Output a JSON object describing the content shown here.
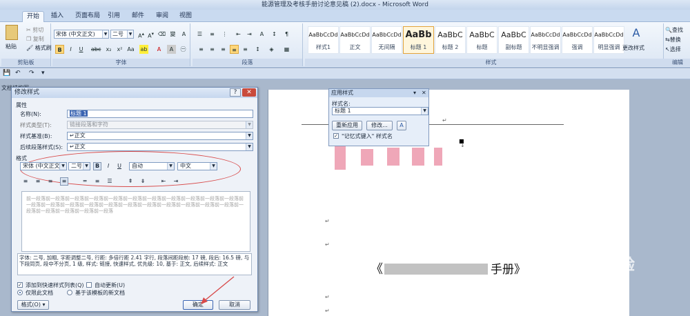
{
  "window": {
    "title": "能源管理及考核手册讨论意见稿 (2).docx - Microsoft Word"
  },
  "tabs": [
    "开始",
    "插入",
    "页面布局",
    "引用",
    "邮件",
    "审阅",
    "视图"
  ],
  "ribbon": {
    "clipboard": {
      "paste": "粘贴",
      "cut": "剪切",
      "copy": "复制",
      "format_painter": "格式刷",
      "label": "剪贴板"
    },
    "font": {
      "name": "宋体 (中文正文)",
      "size": "二号",
      "label": "字体"
    },
    "paragraph": {
      "label": "段落"
    },
    "styles": {
      "label": "样式",
      "change_styles": "更改样式",
      "tiles": [
        {
          "sample": "AaBbCcDd",
          "name": "样式1"
        },
        {
          "sample": "AaBbCcDd",
          "name": "正文"
        },
        {
          "sample": "AaBbCcDd",
          "name": "无间隔"
        },
        {
          "sample": "AaBb",
          "name": "标题 1"
        },
        {
          "sample": "AaBbC",
          "name": "标题 2"
        },
        {
          "sample": "AaBbC",
          "name": "标题"
        },
        {
          "sample": "AaBbC",
          "name": "副标题"
        },
        {
          "sample": "AaBbCcDd",
          "name": "不明显强调"
        },
        {
          "sample": "AaBbCcDd",
          "name": "强调"
        },
        {
          "sample": "AaBbCcDd",
          "name": "明显强调"
        }
      ]
    },
    "editing": {
      "find": "查找",
      "replace": "替换",
      "select": "选择",
      "label": "编辑"
    }
  },
  "nav_label": "文档结构图",
  "apply_pane": {
    "title": "应用样式",
    "name_label": "样式名:",
    "name_value": "标题 1",
    "reapply": "重新应用",
    "modify": "修改...",
    "autocomplete": "\"记忆式键入\" 样式名"
  },
  "dialog": {
    "title": "修改样式",
    "help": "?",
    "properties_label": "属性",
    "name_label": "名称(N):",
    "name_value": "标题 1",
    "type_label": "样式类型(T):",
    "type_value": "链接段落和字符",
    "based_label": "样式基准(B):",
    "based_value": "正文",
    "next_label": "后续段落样式(S):",
    "next_value": "正文",
    "format_label": "格式",
    "font_value": "宋体 (中文正文)",
    "size_value": "二号",
    "color_value": "自动",
    "lang_value": "中文",
    "preview_text": "前一段落前一段落前一段落前一段落前一段落前一段落前一段落前一段落前一段落前一段落前一段落前一段落前一段落前一段落前一段落前一段落前一段落前一段落前一段落前一段落前一段落前一段落前一段落前一段落前一段落前一段落前一段落",
    "description": "字体: 二号, 加粗, 字距调整二号, 行距: 多倍行距 2.41 字行, 段落间距段前: 17 磅, 段后: 16.5 磅, 与下段同页, 段中不分页, 1 级, 样式: 链接, 快速样式, 优先级: 10, 基于: 正文, 后续样式: 正文",
    "add_quick": "添加到快速样式列表(Q)",
    "auto_update": "自动更新(U)",
    "only_doc": "仅限此文档",
    "new_docs": "基于该模板的新文档",
    "format_button": "格式(O)",
    "ok": "确定",
    "cancel": "取消"
  },
  "document": {
    "title_suffix": "手册》"
  },
  "watermark": {
    "brand": "Baidu",
    "cn": "经验",
    "url": "jingyan.baidu.com"
  }
}
